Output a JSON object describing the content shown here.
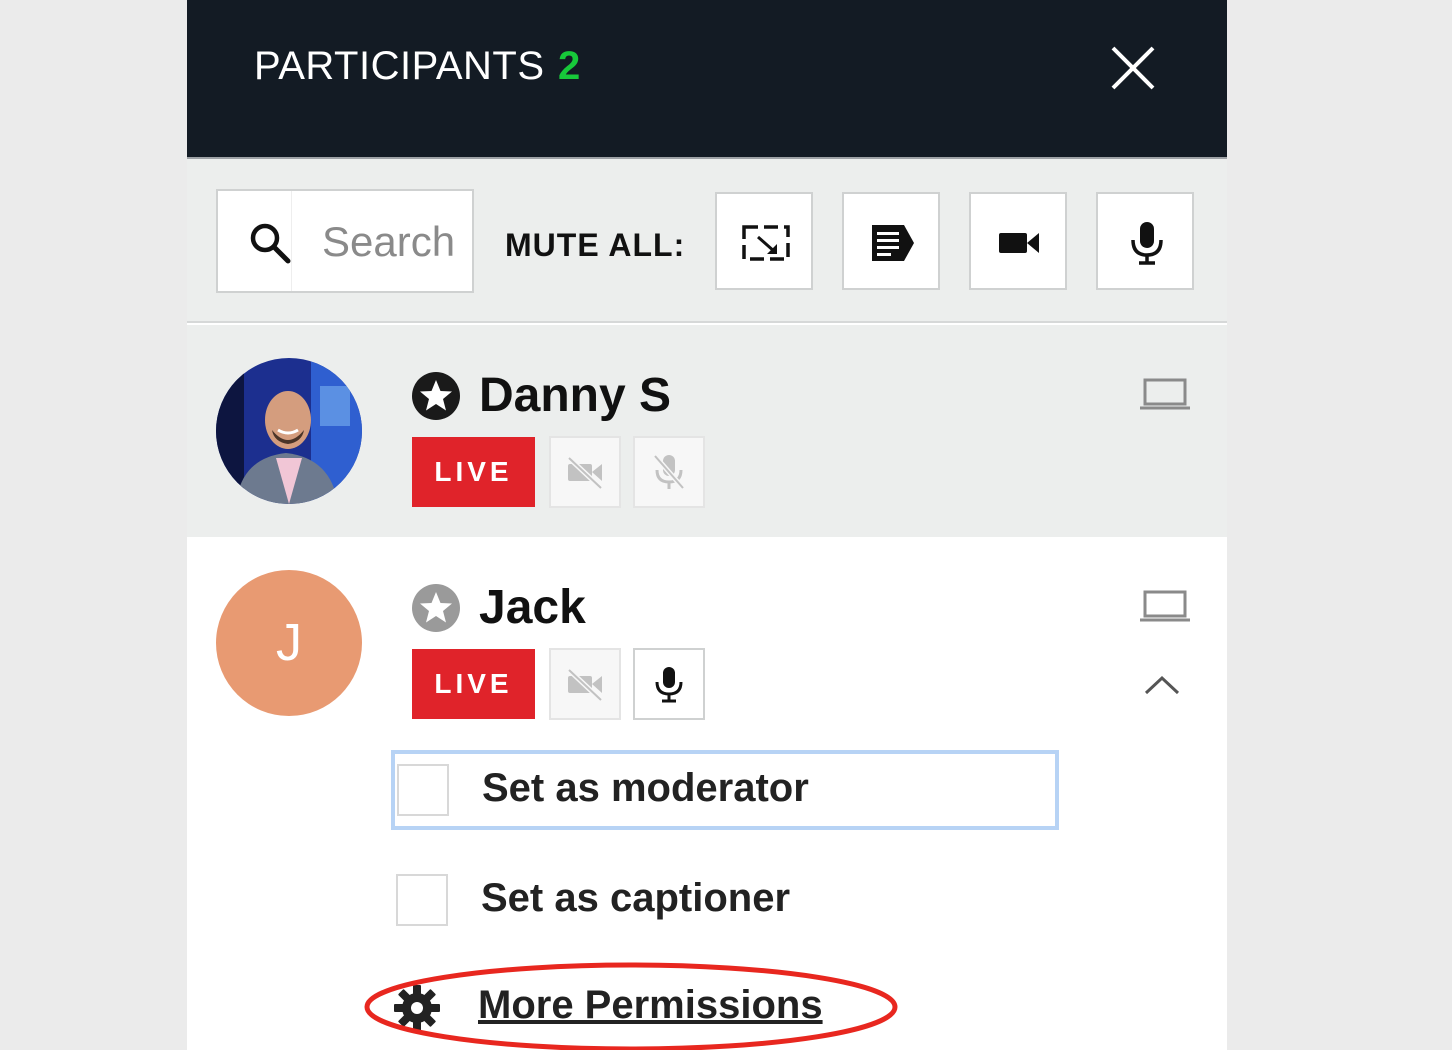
{
  "header": {
    "title": "PARTICIPANTS",
    "count": "2"
  },
  "toolbar": {
    "search_placeholder": "Search",
    "mute_all_label": "MUTE ALL:",
    "buttons": [
      "screenshare-icon",
      "caption-icon",
      "video-camera-icon",
      "microphone-icon"
    ]
  },
  "participants": [
    {
      "name": "Danny S",
      "live_label": "LIVE",
      "moderator": true,
      "video_muted": true,
      "audio_muted": true,
      "device": "laptop-icon"
    },
    {
      "name": "Jack",
      "initial": "J",
      "live_label": "LIVE",
      "moderator": false,
      "video_muted": true,
      "audio_muted": false,
      "device": "laptop-icon",
      "expanded": true
    }
  ],
  "permissions": {
    "set_moderator": "Set as moderator",
    "set_captioner": "Set as captioner",
    "more": "More Permissions"
  },
  "colors": {
    "header_bg": "#131b24",
    "count": "#17c93a",
    "live": "#e0232a",
    "avatar_jack": "#e89a72",
    "highlight": "#e8271f",
    "focus": "#b7d3f5"
  }
}
